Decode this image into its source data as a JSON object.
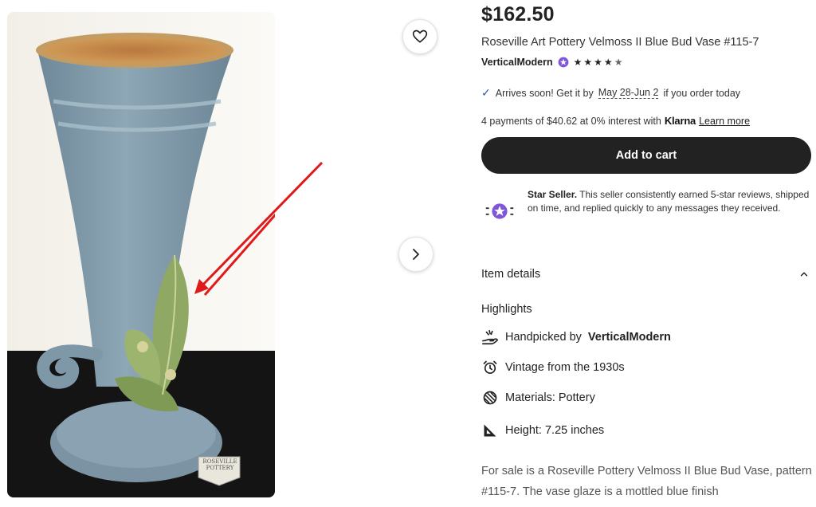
{
  "product": {
    "price": "$162.50",
    "title": "Roseville Art Pottery Velmoss II Blue Bud Vase #115-7",
    "seller": "VerticalModern",
    "rating": 4.5
  },
  "shipping": {
    "prefix": "Arrives soon! Get it by",
    "dates": "May 28-Jun 2",
    "suffix": "if you order today"
  },
  "payments": {
    "text": "4 payments of $40.62 at 0% interest with",
    "provider": "Klarna",
    "learn_more": "Learn more"
  },
  "cart": {
    "label": "Add to cart"
  },
  "star_seller": {
    "title": "Star Seller.",
    "text": "This seller consistently earned 5-star reviews, shipped on time, and replied quickly to any messages they received."
  },
  "details": {
    "title": "Item details",
    "highlights_title": "Highlights",
    "highlights": [
      {
        "icon": "hand-icon",
        "prefix": "Handpicked by",
        "bold": "VerticalModern"
      },
      {
        "icon": "alarm-clock-icon",
        "text": "Vintage from the 1930s"
      },
      {
        "icon": "materials-icon",
        "text": "Materials: Pottery"
      },
      {
        "icon": "ruler-triangle-icon",
        "text": "Height: 7.25 inches"
      }
    ]
  },
  "description": "For sale is a Roseville Pottery Velmoss II Blue Bud Vase, pattern #115-7. The vase glaze is a mottled blue finish",
  "image": {
    "label_text_line1": "ROSEVILLE",
    "label_text_line2": "POTTERY",
    "colors": {
      "vase_blue": "#7f98a8",
      "leaf_green": "#8fa864",
      "arrow_red": "#e0191b"
    }
  }
}
